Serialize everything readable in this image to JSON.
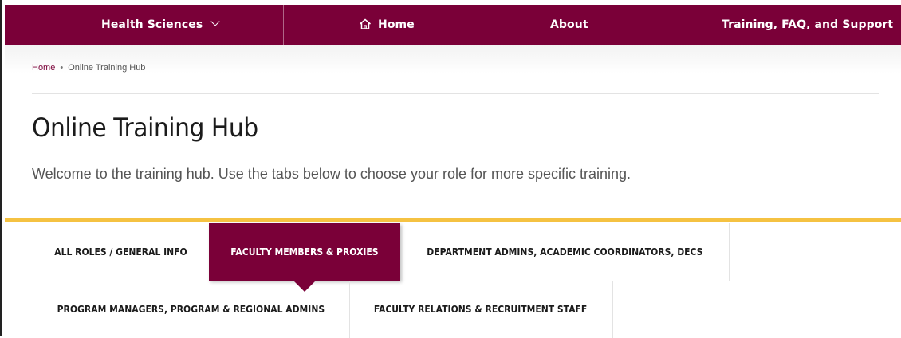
{
  "colors": {
    "brand": "#7a0038",
    "accent_gold": "#f5c242",
    "text_dark": "#1b1b1b",
    "text_muted": "#555555"
  },
  "topnav": {
    "site_menu_label": "Health Sciences",
    "home_label": "Home",
    "about_label": "About",
    "support_label": "Training, FAQ, and Support",
    "icons": {
      "home": "home-icon",
      "chevron": "chevron-down-icon"
    }
  },
  "breadcrumb": {
    "home": "Home",
    "separator": "•",
    "current": "Online Training Hub"
  },
  "page": {
    "title": "Online Training Hub",
    "intro": "Welcome to the training hub. Use the tabs below to choose your role for more specific training."
  },
  "tabs": [
    {
      "label": "ALL ROLES / GENERAL INFO",
      "active": false
    },
    {
      "label": "FACULTY MEMBERS & PROXIES",
      "active": true
    },
    {
      "label": "DEPARTMENT ADMINS, ACADEMIC COORDINATORS, DECS",
      "active": false
    },
    {
      "label": "PROGRAM MANAGERS, PROGRAM & REGIONAL ADMINS",
      "active": false
    },
    {
      "label": "FACULTY RELATIONS & RECRUITMENT STAFF",
      "active": false
    }
  ]
}
